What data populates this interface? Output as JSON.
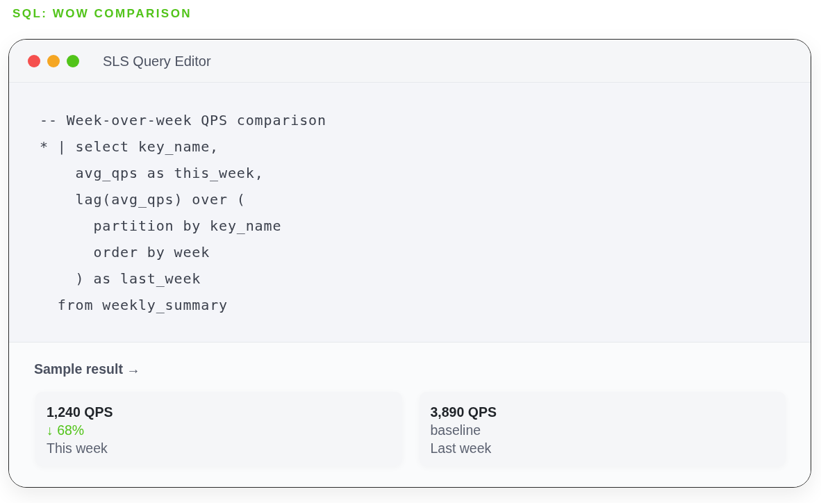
{
  "heading": "SQL: WOW COMPARISON",
  "window": {
    "title": "SLS Query Editor"
  },
  "code_lines": [
    "-- Week-over-week QPS comparison",
    "* | select key_name,",
    "    avg_qps as this_week,",
    "    lag(avg_qps) over (",
    "      partition by key_name",
    "      order by week",
    "    ) as last_week",
    "  from weekly_summary"
  ],
  "result": {
    "title": "Sample result →",
    "cards": [
      {
        "value": "1,240 QPS",
        "change": {
          "text": "↓ 68%",
          "kind": "delta"
        },
        "label": "This week"
      },
      {
        "value": "3,890 QPS",
        "change": {
          "text": "baseline",
          "kind": "neutral"
        },
        "label": "Last week"
      }
    ]
  }
}
